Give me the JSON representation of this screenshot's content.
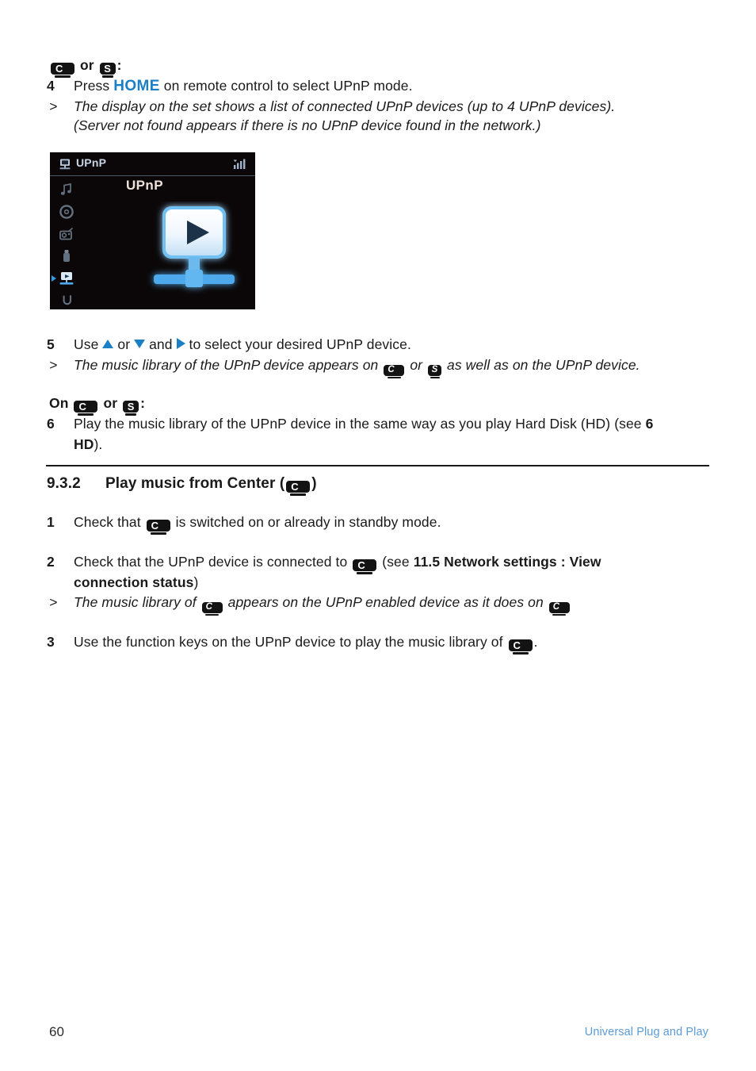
{
  "page": {
    "number": "60",
    "footer_right": "Universal Plug and Play",
    "accent_blue": "#1b7fc6",
    "footer_blue": "#5b9bd5"
  },
  "badges": {
    "center": "C",
    "station": "S"
  },
  "section_upnp_continued": {
    "device_line_or": "or",
    "device_line_colon": ":",
    "step4": {
      "number": "4",
      "text_before": "Press",
      "keyword": "HOME",
      "text_after": "on remote control to select UPnP mode."
    },
    "result4": {
      "marker": ">",
      "line1": "The display on the set shows a list of connected UPnP devices (up to 4 UPnP devices).",
      "line2": "(Server not found appears if there is no UPnP device found in the network.)"
    },
    "step5": {
      "number": "5",
      "text_use": "Use",
      "text_or": "or",
      "text_and": "and",
      "text_after": "to select your desired UPnP device."
    },
    "result5": {
      "marker": ">",
      "part1": "The music library of the UPnP device appears on",
      "part_or": "or",
      "part2": "as well as on the UPnP device."
    },
    "on_line": {
      "on": "On",
      "or": "or",
      "colon": ":"
    },
    "step6": {
      "number": "6",
      "line1_a": "Play the music library of the UPnP device in the same way as you play Hard Disk (HD) (see",
      "line1_b": "6",
      "line2_bold": "HD",
      "line2_rest": ")."
    }
  },
  "lcd": {
    "header_title": "UPnP",
    "header_icon": "upnp-device-icon",
    "signal_icon": "signal-strength-icon",
    "screen_title": "UPnP",
    "artwork_icon": "upnp-network-play-icon",
    "sidebar_items": [
      {
        "name": "music-note-icon",
        "selected": false
      },
      {
        "name": "cd-disc-icon",
        "selected": false
      },
      {
        "name": "radio-icon",
        "selected": false
      },
      {
        "name": "usb-stick-icon",
        "selected": false
      },
      {
        "name": "upnp-icon",
        "selected": true
      },
      {
        "name": "return-arrow-icon",
        "selected": false
      }
    ]
  },
  "section_932": {
    "number": "9.3.2",
    "title_before": "Play music from Center (",
    "title_after": ")",
    "step1": {
      "number": "1",
      "text_before": "Check that",
      "text_after": "is switched on or already in standby mode."
    },
    "step2": {
      "number": "2",
      "line1_before": "Check that the UPnP device is connected to",
      "line1_after": "(see",
      "line1_bold": "11.5 Network settings : View",
      "line2_bold": "connection status",
      "line2_after": ")"
    },
    "result2": {
      "marker": ">",
      "part1": "The music library of",
      "part2": "appears on the UPnP enabled device as it does on"
    },
    "step3": {
      "number": "3",
      "text_before": "Use the function keys on the UPnP device to play the music library of",
      "text_after": "."
    }
  }
}
